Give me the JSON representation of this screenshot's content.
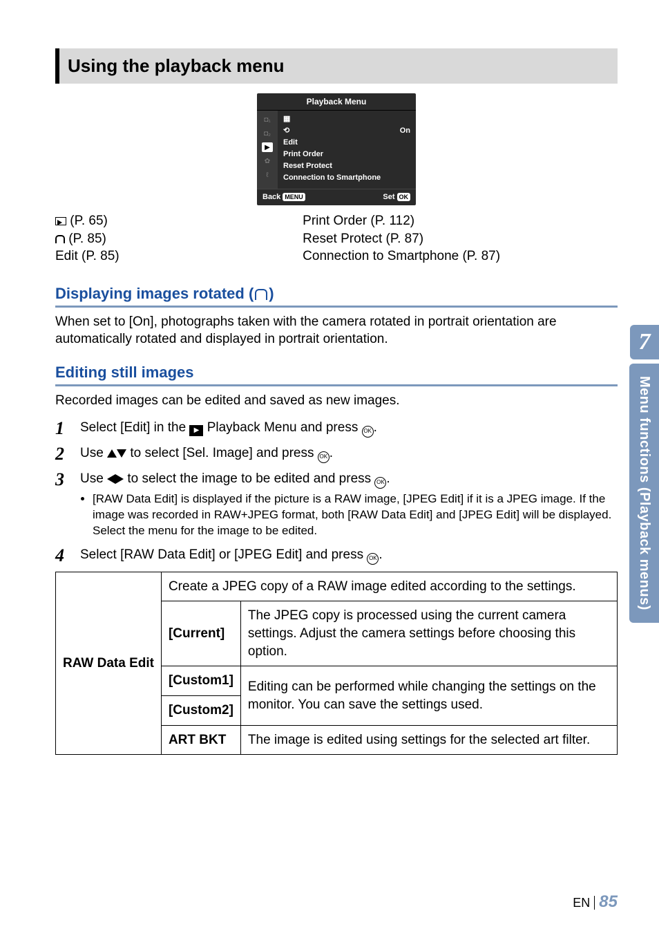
{
  "section_title": " Using the playback menu",
  "menu_screenshot": {
    "title": "Playback Menu",
    "items": [
      {
        "label": "",
        "value": "",
        "is_icon": true,
        "icon": "slideshow"
      },
      {
        "label": "",
        "value": "On",
        "is_icon": true,
        "icon": "rotate"
      },
      {
        "label": "Edit",
        "value": ""
      },
      {
        "label": "Print Order",
        "value": ""
      },
      {
        "label": "Reset Protect",
        "value": ""
      },
      {
        "label": "Connection to Smartphone",
        "value": ""
      }
    ],
    "footer_left": "Back",
    "footer_left_badge": "MENU",
    "footer_right": "Set",
    "footer_right_badge": "OK"
  },
  "cross_refs": {
    "left": [
      " (P. 65)",
      " (P. 85)",
      "Edit (P. 85)"
    ],
    "right": [
      "Print Order (P. 112)",
      "Reset Protect (P. 87)",
      "Connection to Smartphone (P. 87)"
    ]
  },
  "rotated": {
    "heading_prefix": "Displaying images rotated (",
    "heading_suffix": ")",
    "para": "When set to [On], photographs taken with the camera rotated in portrait orientation are automatically rotated and displayed in portrait orientation."
  },
  "editing": {
    "heading": "Editing still images",
    "intro": "Recorded images can be edited and saved as new images."
  },
  "steps": {
    "s1a": "Select [Edit] in the ",
    "s1b": " Playback Menu and press ",
    "s1c": ".",
    "s2a": "Use ",
    "s2b": " to select [Sel. Image] and press ",
    "s2c": ".",
    "s3a": "Use ",
    "s3b": " to select the image to be edited and press ",
    "s3c": ".",
    "s3_bullet": "[RAW Data Edit] is displayed if the picture is a RAW image, [JPEG Edit] if it is a JPEG image. If the image was recorded in RAW+JPEG format, both [RAW Data Edit] and [JPEG Edit] will be displayed. Select the menu for the image to be edited.",
    "s4a": "Select [RAW Data Edit] or [JPEG Edit] and press ",
    "s4b": "."
  },
  "table": {
    "row_header": "RAW Data Edit",
    "top_row": "Create a JPEG copy of a RAW image edited according to the settings.",
    "current_label": "[Current]",
    "current_desc": "The JPEG copy is processed using the current camera settings. Adjust the camera settings before choosing this option.",
    "custom1_label": "[Custom1]",
    "custom2_label": "[Custom2]",
    "custom_desc": "Editing can be performed while changing the settings on the monitor. You can save the settings used.",
    "artbkt_label": "ART BKT",
    "artbkt_desc": "The image is edited using settings for the selected art filter."
  },
  "tab": {
    "chapter": "7",
    "label": "Menu functions (Playback menus)"
  },
  "footer": {
    "lang": "EN",
    "page": "85"
  }
}
